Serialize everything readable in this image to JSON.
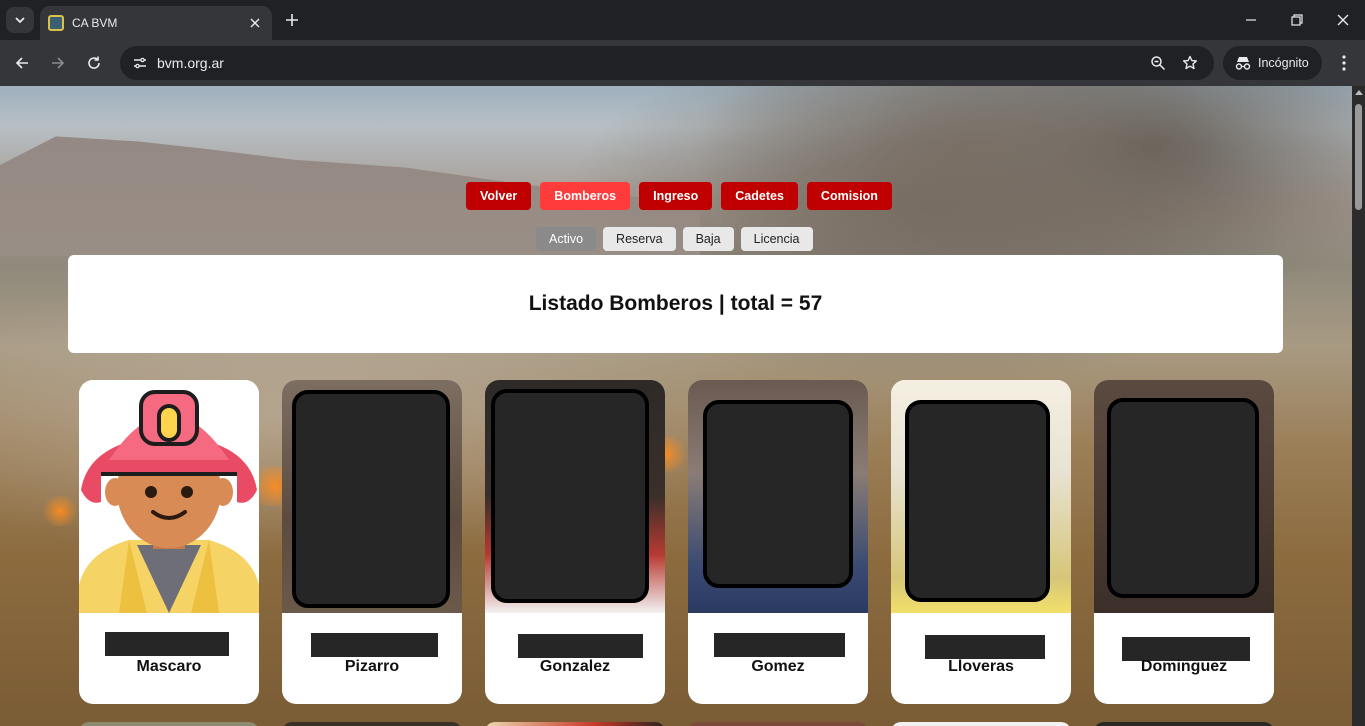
{
  "browser": {
    "tab_title": "CA BVM",
    "url": "bvm.org.ar",
    "incognito_label": "Incógnito"
  },
  "nav": {
    "main": [
      "Volver",
      "Bomberos",
      "Ingreso",
      "Cadetes",
      "Comision"
    ],
    "main_active": "Bomberos",
    "status": [
      "Activo",
      "Reserva",
      "Baja",
      "Licencia"
    ],
    "status_active": "Activo"
  },
  "listing": {
    "title": "Listado Bomberos | total = 57"
  },
  "firefighters": [
    {
      "surname": "Mascaro",
      "photo": "avatar-placeholder"
    },
    {
      "surname": "Pizarro",
      "photo": "redacted"
    },
    {
      "surname": "Gonzalez",
      "photo": "redacted"
    },
    {
      "surname": "Gomez",
      "photo": "redacted"
    },
    {
      "surname": "Lloveras",
      "photo": "redacted"
    },
    {
      "surname": "Dominguez",
      "photo": "redacted"
    }
  ],
  "colors": {
    "nav_red": "#c00000",
    "nav_red_active": "#ff3b3b",
    "status_active": "#8a8a8a",
    "redaction": "#262626"
  }
}
